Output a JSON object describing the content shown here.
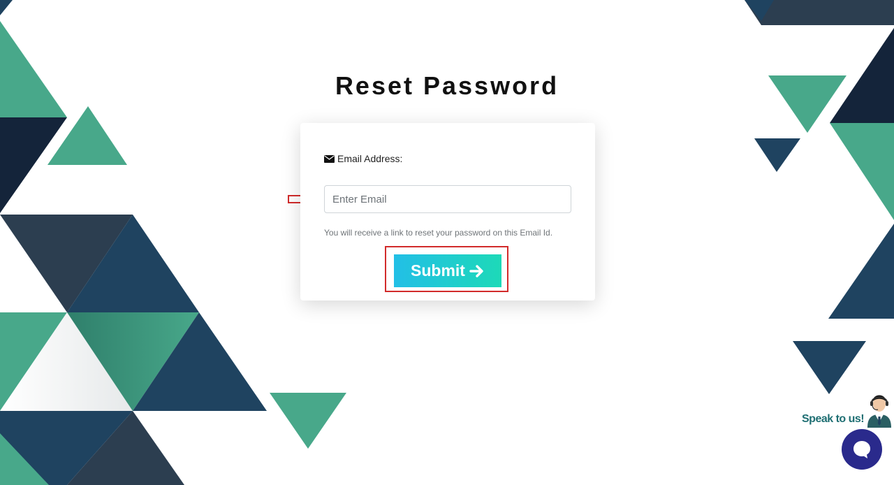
{
  "page": {
    "title": "Reset Password"
  },
  "form": {
    "email_label": "Email Address:",
    "email_placeholder": "Enter Email",
    "email_value": "",
    "helper_text": "You will receive a link to reset your password on this Email Id.",
    "submit_label": "Submit"
  },
  "chat_widget": {
    "prompt_text": "Speak to us!"
  },
  "icons": {
    "email_label_icon": "envelope-icon",
    "submit_icon": "arrow-right-icon",
    "annotation_arrows": "outline-arrow-right-icon",
    "chat_icon": "chat-bubble-icon",
    "agent": "support-agent-icon"
  },
  "colors": {
    "teal": "#48a88a",
    "navy": "#1f4360",
    "dark_navy": "#14243a",
    "slate": "#2c3e50",
    "annotation_red": "#d22b2b",
    "button_gradient_start": "#22bfe6",
    "button_gradient_end": "#1dd9b8",
    "chat_button": "#2a2a8c",
    "speak_text": "#1f6f73"
  }
}
